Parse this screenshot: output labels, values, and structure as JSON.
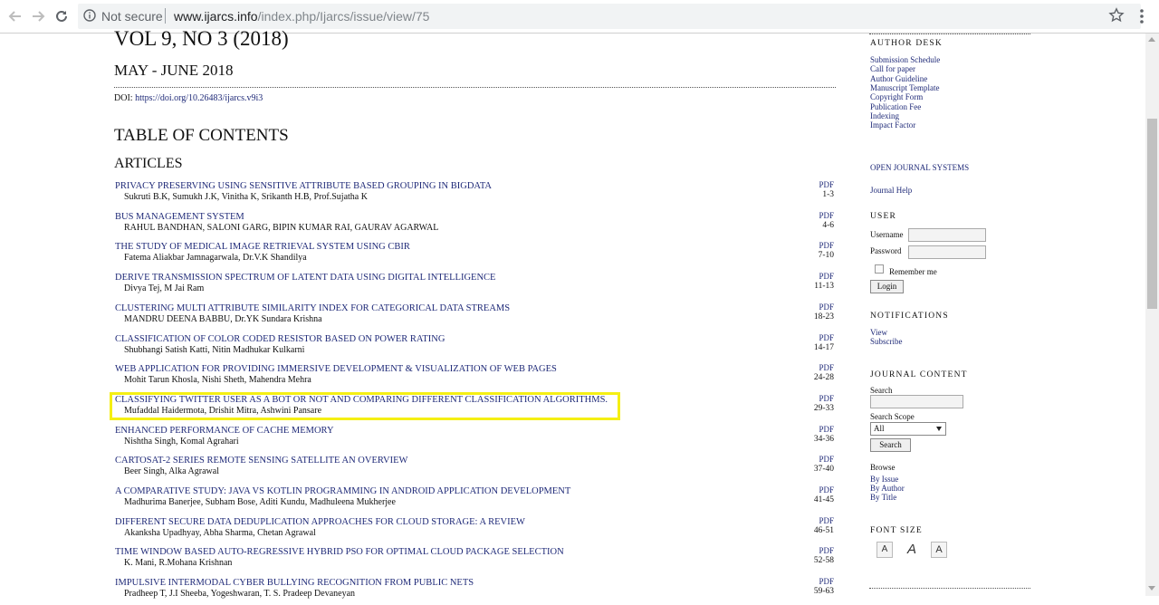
{
  "browser": {
    "security_label": "Not secure",
    "url_host": "www.ijarcs.info",
    "url_path": "/index.php/Ijarcs/issue/view/75",
    "icons": [
      "back-arrow-icon",
      "forward-arrow-icon",
      "reload-icon",
      "info-icon",
      "star-icon",
      "menu-icon"
    ]
  },
  "issue": {
    "volume_title": "VOL 9, NO 3 (2018)",
    "date": "MAY - JUNE 2018",
    "doi_label": "DOI:",
    "doi_link": "https://doi.org/10.26483/ijarcs.v9i3",
    "toc_heading": "TABLE OF CONTENTS",
    "section_heading": "ARTICLES"
  },
  "articles": [
    {
      "title": "PRIVACY PRESERVING USING SENSITIVE ATTRIBUTE BASED GROUPING IN BIGDATA",
      "authors": "Sukruti B.K, Sumukh J.K, Vinitha K, Srikanth H.B, Prof.Sujatha K",
      "pdf": "PDF",
      "pages": "1-3"
    },
    {
      "title": "BUS MANAGEMENT SYSTEM",
      "authors": "RAHUL BANDHAN, SALONI GARG, BIPIN KUMAR RAI, GAURAV AGARWAL",
      "pdf": "PDF",
      "pages": "4-6"
    },
    {
      "title": "THE STUDY OF MEDICAL IMAGE RETRIEVAL SYSTEM USING CBIR",
      "authors": "Fatema Aliakbar Jamnagarwala, Dr.V.K Shandilya",
      "pdf": "PDF",
      "pages": "7-10"
    },
    {
      "title": "DERIVE TRANSMISSION SPECTRUM OF LATENT DATA USING DIGITAL INTELLIGENCE",
      "authors": "Divya Tej, M Jai Ram",
      "pdf": "PDF",
      "pages": "11-13"
    },
    {
      "title": "CLUSTERING MULTI ATTRIBUTE SIMILARITY INDEX FOR CATEGORICAL DATA STREAMS",
      "authors": "MANDRU DEENA BABBU, Dr.YK Sundara Krishna",
      "pdf": "PDF",
      "pages": "18-23"
    },
    {
      "title": "CLASSIFICATION OF COLOR CODED RESISTOR BASED ON POWER RATING",
      "authors": "Shubhangi Satish Katti, Nitin Madhukar Kulkarni",
      "pdf": "PDF",
      "pages": "14-17"
    },
    {
      "title": "WEB APPLICATION FOR PROVIDING IMMERSIVE DEVELOPMENT & VISUALIZATION OF WEB PAGES",
      "authors": "Mohit Tarun Khosla, Nishi Sheth, Mahendra Mehra",
      "pdf": "PDF",
      "pages": "24-28"
    },
    {
      "title": "CLASSIFYING TWITTER USER AS A BOT OR NOT AND COMPARING DIFFERENT CLASSIFICATION ALGORITHMS.",
      "authors": "Mufaddal Haidermota, Drishit Mitra, Ashwini Pansare",
      "pdf": "PDF",
      "pages": "29-33"
    },
    {
      "title": "ENHANCED PERFORMANCE OF CACHE MEMORY",
      "authors": "Nishtha Singh, Komal Agrahari",
      "pdf": "PDF",
      "pages": "34-36"
    },
    {
      "title": "CARTOSAT-2 SERIES REMOTE SENSING SATELLITE AN OVERVIEW",
      "authors": "Beer Singh, Alka Agrawal",
      "pdf": "PDF",
      "pages": "37-40"
    },
    {
      "title": "A COMPARATIVE STUDY: JAVA VS KOTLIN PROGRAMMING IN ANDROID APPLICATION DEVELOPMENT",
      "authors": "Madhurima Banerjee, Subham Bose, Aditi Kundu, Madhuleena Mukherjee",
      "pdf": "PDF",
      "pages": "41-45"
    },
    {
      "title": "DIFFERENT SECURE DATA DEDUPLICATION APPROACHES FOR CLOUD STORAGE: A REVIEW",
      "authors": "Akanksha Upadhyay, Abha Sharma, Chetan Agrawal",
      "pdf": "PDF",
      "pages": "46-51"
    },
    {
      "title": "TIME WINDOW BASED AUTO-REGRESSIVE HYBRID PSO FOR OPTIMAL CLOUD PACKAGE SELECTION",
      "authors": "K. Mani, R.Mohana Krishnan",
      "pdf": "PDF",
      "pages": "52-58"
    },
    {
      "title": "IMPULSIVE INTERMODAL CYBER BULLYING RECOGNITION FROM PUBLIC NETS",
      "authors": "Pradheep T, J.I Sheeba, Yogeshwaran, T. S. Pradeep Devaneyan",
      "pdf": "PDF",
      "pages": "59-63"
    }
  ],
  "highlight_color": "#f5ef13",
  "sidebar": {
    "author_desk": {
      "heading": "AUTHOR DESK",
      "links": [
        "Submission Schedule",
        "Call for paper",
        "Author Guideline",
        "Manuscript Template",
        "Copyright Form",
        "Publication Fee",
        "Indexing",
        "Impact Factor"
      ]
    },
    "ojs_link": "OPEN JOURNAL SYSTEMS",
    "journal_help": "Journal Help",
    "user": {
      "heading": "USER",
      "username_label": "Username",
      "password_label": "Password",
      "remember_label": "Remember me",
      "login_button": "Login"
    },
    "notifications": {
      "heading": "NOTIFICATIONS",
      "links": [
        "View",
        "Subscribe"
      ]
    },
    "journal_content": {
      "heading": "JOURNAL CONTENT",
      "search_label": "Search",
      "scope_label": "Search Scope",
      "scope_value": "All",
      "search_button": "Search",
      "browse_label": "Browse",
      "browse_links": [
        "By Issue",
        "By Author",
        "By Title"
      ]
    },
    "font_size": {
      "heading": "FONT SIZE",
      "buttons": [
        "A",
        "A",
        "A"
      ]
    }
  }
}
